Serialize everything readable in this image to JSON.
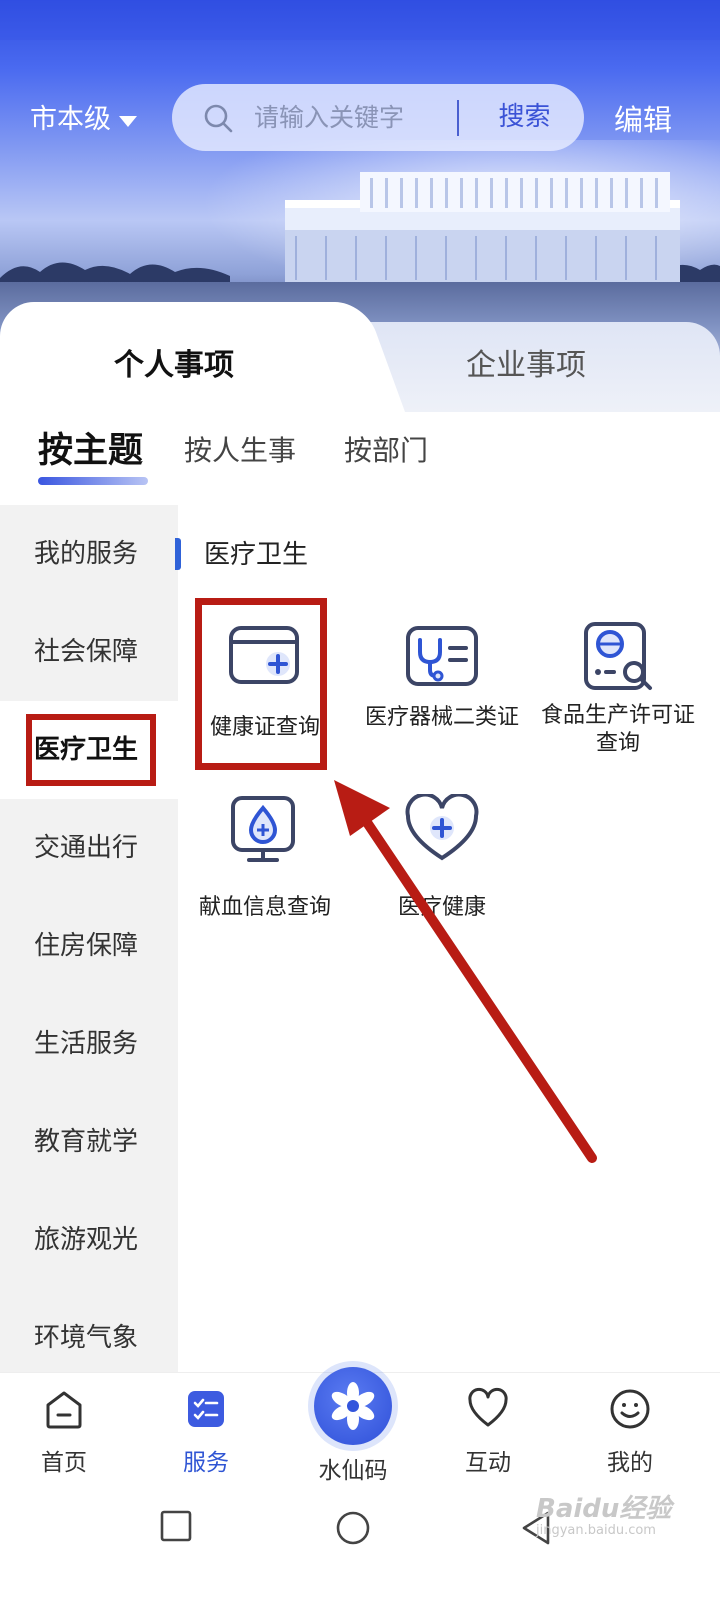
{
  "header": {
    "city": "市本级",
    "search_placeholder": "请输入关键字",
    "search_button": "搜索",
    "edit": "编辑"
  },
  "tabs": {
    "personal": "个人事项",
    "enterprise": "企业事项"
  },
  "subtabs": [
    "按主题",
    "按人生事",
    "按部门"
  ],
  "sidebar": [
    "我的服务",
    "社会保障",
    "医疗卫生",
    "交通出行",
    "住房保障",
    "生活服务",
    "教育就学",
    "旅游观光",
    "环境气象"
  ],
  "section": {
    "title": "医疗卫生",
    "services": [
      {
        "label": "健康证查询",
        "icon": "health-card-icon"
      },
      {
        "label": "医疗器械二类证",
        "icon": "medical-device-icon"
      },
      {
        "label": "食品生产许可证查询",
        "icon": "food-license-icon"
      },
      {
        "label": "献血信息查询",
        "icon": "blood-donation-icon"
      },
      {
        "label": "医疗健康",
        "icon": "heart-plus-icon"
      }
    ]
  },
  "bottom_nav": {
    "home": "首页",
    "service": "服务",
    "center": "水仙码",
    "interact": "互动",
    "mine": "我的"
  },
  "watermark": {
    "brand": "Baidu经验",
    "domain": "jingyan.baidu.com"
  },
  "colors": {
    "accent": "#2f55d4",
    "highlight_box": "#b81c14",
    "arrow": "#b81c14"
  }
}
